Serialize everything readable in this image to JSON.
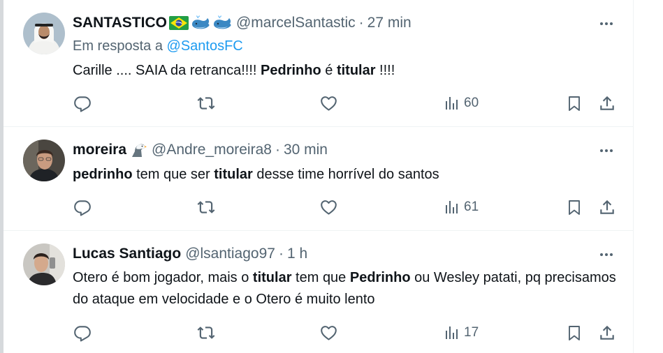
{
  "tweets": [
    {
      "display_name": "SANTASTICO",
      "name_emojis": [
        "brazil-flag-icon",
        "whale-icon",
        "whale-icon"
      ],
      "handle": "@marcelSantastic",
      "separator": "·",
      "time": "27 min",
      "reply_prefix": "Em resposta a",
      "reply_mention": "@SantosFC",
      "text_parts": [
        {
          "t": "Carille .... SAIA da retranca!!!! ",
          "b": false
        },
        {
          "t": "Pedrinho",
          "b": true
        },
        {
          "t": " é ",
          "b": false
        },
        {
          "t": "titular",
          "b": true
        },
        {
          "t": " !!!!",
          "b": false
        }
      ],
      "views": "60"
    },
    {
      "display_name": "moreira",
      "name_emojis": [
        "eagle-icon"
      ],
      "handle": "@Andre_moreira8",
      "separator": "·",
      "time": "30 min",
      "text_parts": [
        {
          "t": "pedrinho",
          "b": true
        },
        {
          "t": " tem que ser ",
          "b": false
        },
        {
          "t": "titular",
          "b": true
        },
        {
          "t": " desse time horrível do santos",
          "b": false
        }
      ],
      "views": "61"
    },
    {
      "display_name": "Lucas Santiago",
      "name_emojis": [],
      "handle": "@lsantiago97",
      "separator": "·",
      "time": "1 h",
      "text_parts": [
        {
          "t": "Otero é bom jogador, mais o ",
          "b": false
        },
        {
          "t": "titular",
          "b": true
        },
        {
          "t": " tem que ",
          "b": false
        },
        {
          "t": "Pedrinho",
          "b": true
        },
        {
          "t": " ou Wesley patati, pq precisamos do ataque em velocidade e o Otero é muito lento",
          "b": false
        }
      ],
      "views": "17"
    }
  ],
  "colors": {
    "text": "#0f1419",
    "secondary": "#536471",
    "link": "#1d9bf0",
    "divider": "#eff3f4"
  },
  "icons": [
    "reply-icon",
    "retweet-icon",
    "like-icon",
    "views-icon",
    "bookmark-icon",
    "share-icon",
    "more-icon"
  ]
}
